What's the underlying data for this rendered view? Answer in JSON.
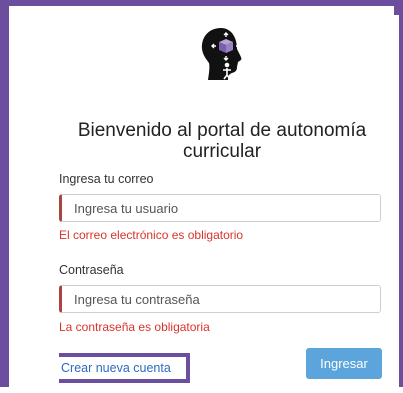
{
  "title": "Bienvenido al portal de autonomía curricular",
  "email": {
    "label": "Ingresa tu correo",
    "placeholder": "Ingresa tu usuario",
    "error": "El correo electrónico es obligatorio"
  },
  "password": {
    "label": "Contraseña",
    "placeholder": "Ingresa tu contraseña",
    "error": "La contraseña es obligatoria"
  },
  "create_account_link": "Crear nueva cuenta",
  "submit_label": "Ingresar",
  "icons": {
    "logo": "head-with-cube-logo-icon"
  },
  "colors": {
    "accent_frame": "#6b4f9e",
    "button": "#5ba4dc",
    "error": "#d9342b",
    "link": "#2d6bbf"
  }
}
